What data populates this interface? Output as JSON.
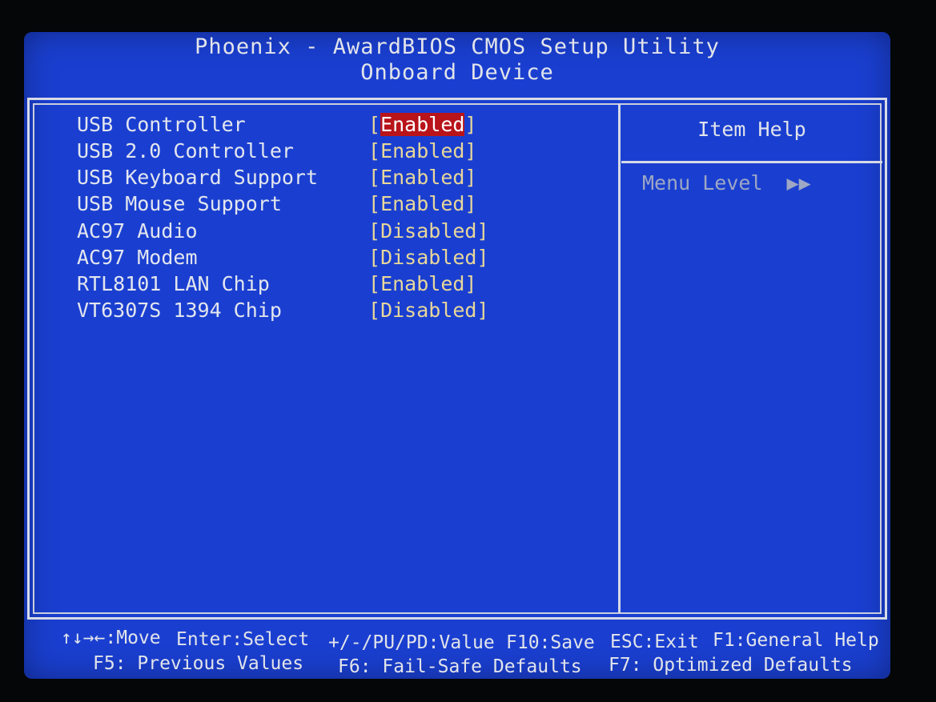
{
  "header": {
    "title": "Phoenix - AwardBIOS CMOS Setup Utility",
    "subtitle": "Onboard Device"
  },
  "settings": [
    {
      "label": "USB Controller",
      "value": "Enabled",
      "selected": true
    },
    {
      "label": "USB 2.0 Controller",
      "value": "Enabled",
      "selected": false
    },
    {
      "label": "USB Keyboard Support",
      "value": "Enabled",
      "selected": false
    },
    {
      "label": "USB Mouse Support",
      "value": "Enabled",
      "selected": false
    },
    {
      "label": "AC97 Audio",
      "value": "Disabled",
      "selected": false
    },
    {
      "label": "AC97 Modem",
      "value": "Disabled",
      "selected": false
    },
    {
      "label": "RTL8101 LAN Chip",
      "value": "Enabled",
      "selected": false
    },
    {
      "label": "VT6307S 1394 Chip",
      "value": "Disabled",
      "selected": false
    }
  ],
  "help": {
    "title": "Item Help",
    "menu_level_label": "Menu Level",
    "menu_level_arrows": "▶▶"
  },
  "footer": {
    "row1": {
      "move": "↑↓→←:Move",
      "select": "Enter:Select",
      "value": "+/-/PU/PD:Value",
      "save": "F10:Save",
      "exit": "ESC:Exit",
      "help": "F1:General Help"
    },
    "row2": {
      "previous": "F5: Previous Values",
      "failsafe": "F6: Fail-Safe Defaults",
      "optimized": "F7: Optimized Defaults"
    }
  },
  "colors": {
    "background": "#1a3fd0",
    "text": "#e3e6ee",
    "value_text": "#e8d79a",
    "selection": "#b8141a",
    "help_text": "#9ea7c4"
  }
}
